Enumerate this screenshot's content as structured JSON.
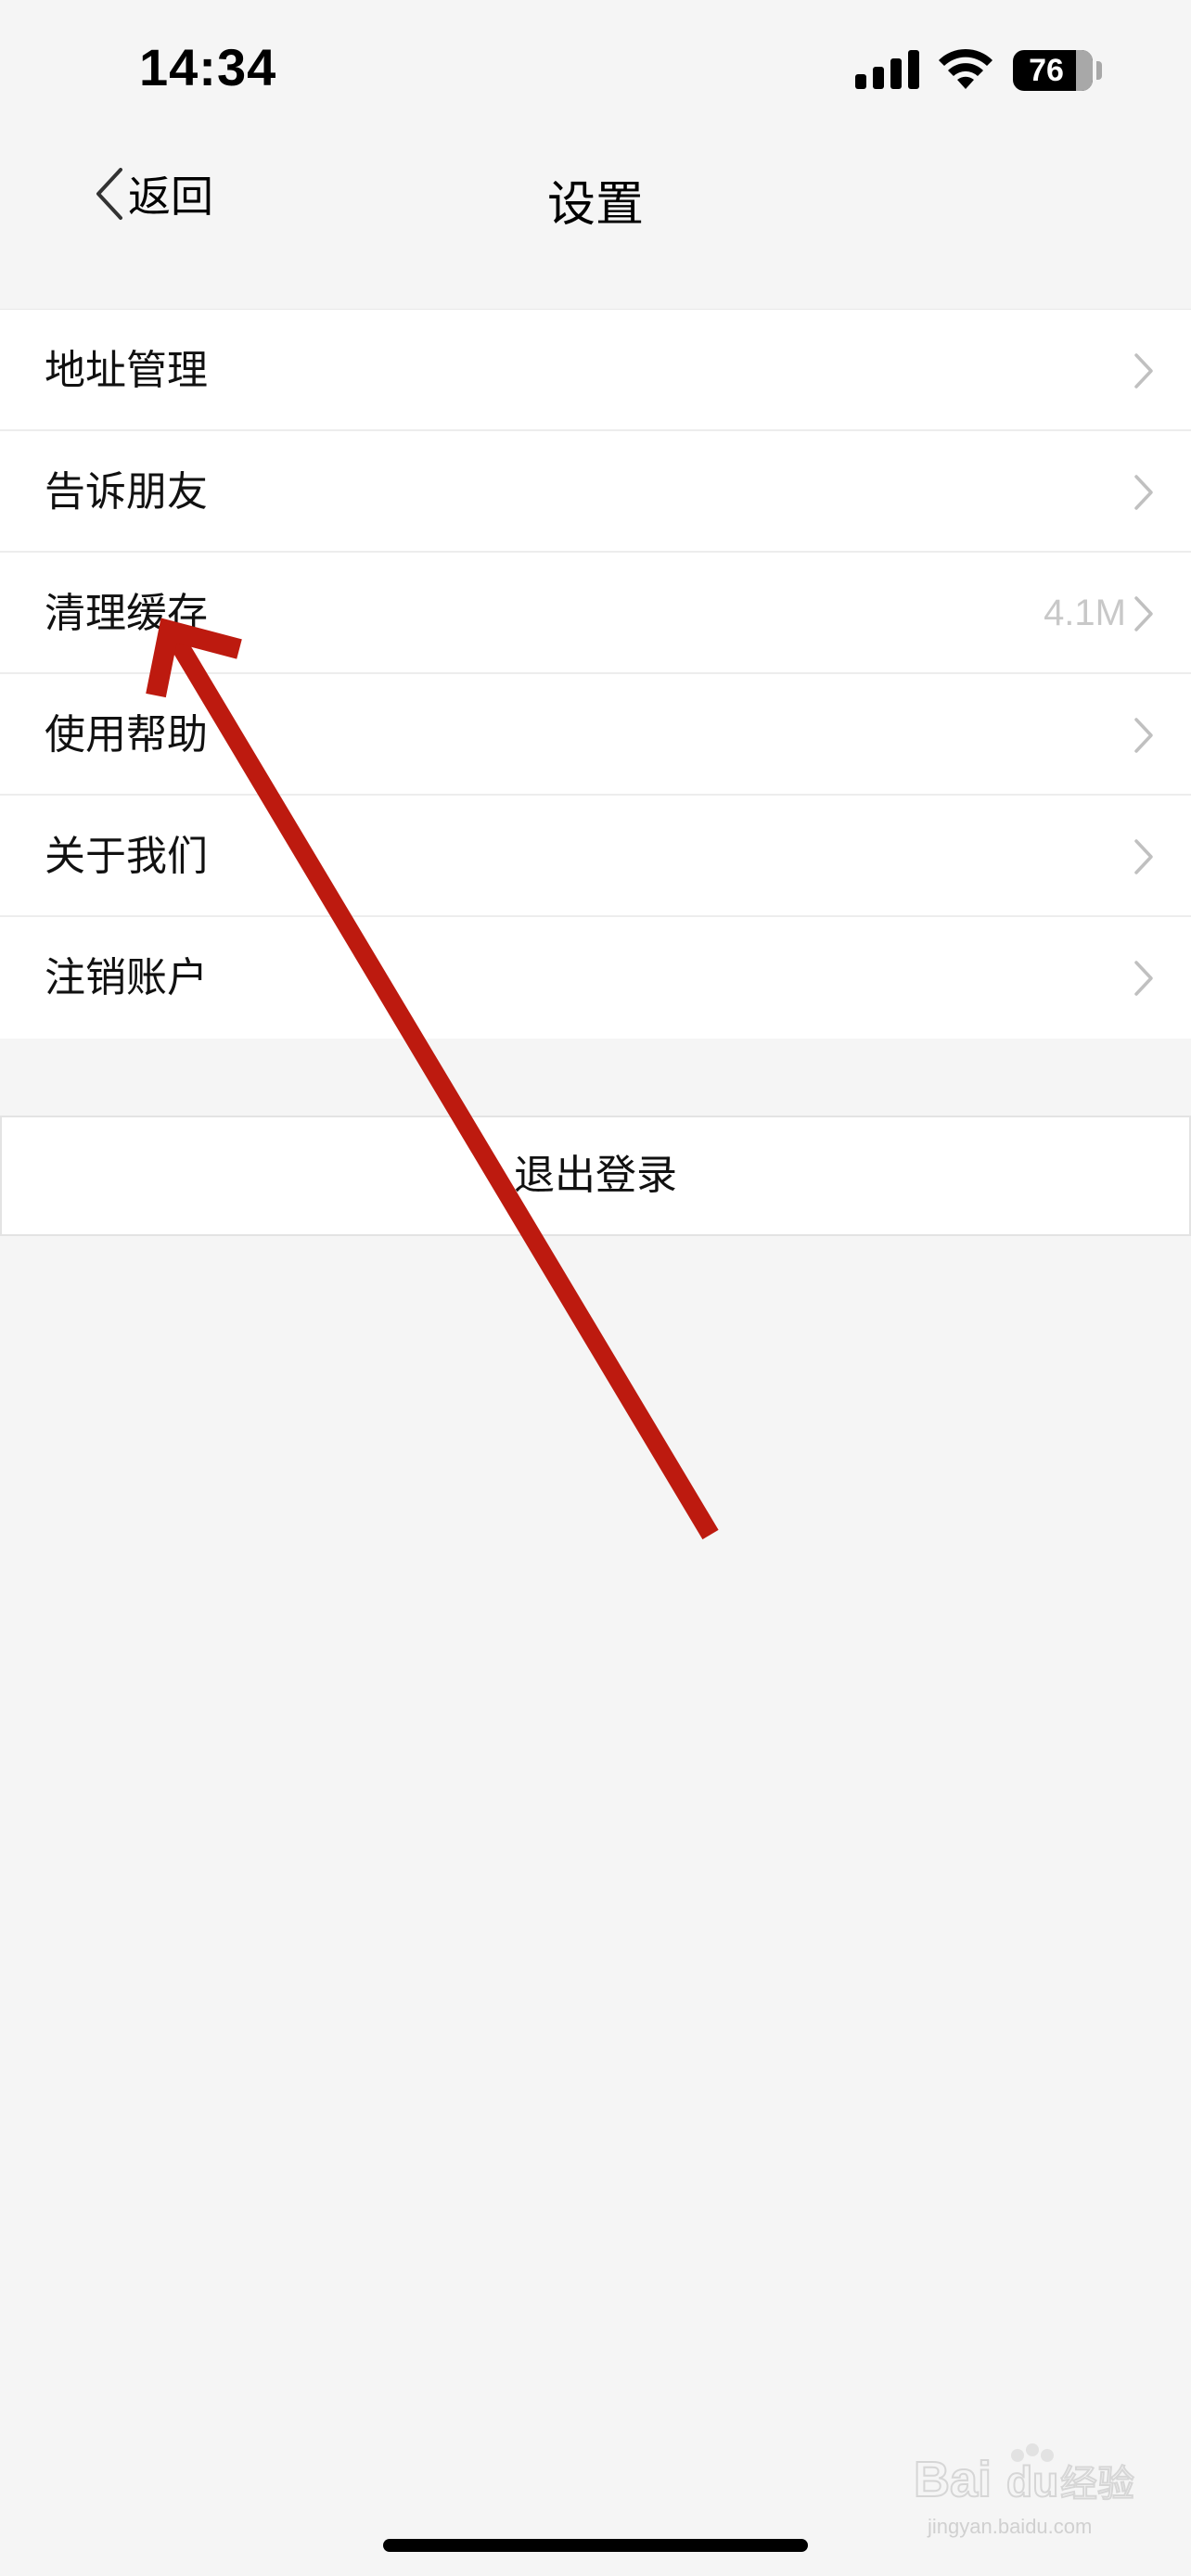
{
  "status_bar": {
    "time": "14:34",
    "battery_level": "76"
  },
  "nav": {
    "back_label": "返回",
    "title": "设置"
  },
  "menu": {
    "items": [
      {
        "label": "地址管理",
        "value": ""
      },
      {
        "label": "告诉朋友",
        "value": ""
      },
      {
        "label": "清理缓存",
        "value": "4.1M"
      },
      {
        "label": "使用帮助",
        "value": ""
      },
      {
        "label": "关于我们",
        "value": ""
      },
      {
        "label": "注销账户",
        "value": ""
      }
    ]
  },
  "logout": {
    "label": "退出登录"
  },
  "watermark": {
    "brand": "Baidu经验",
    "url": "jingyan.baidu.com"
  },
  "colors": {
    "annotation_arrow": "#bd1a0f",
    "background": "#f5f5f5",
    "chevron": "#c0c0c0",
    "value_text": "#c8c8c8"
  },
  "icons": {
    "back": "chevron-left-icon",
    "row": "chevron-right-icon",
    "signal": "cellular-signal-icon",
    "wifi": "wifi-icon",
    "battery": "battery-icon"
  }
}
